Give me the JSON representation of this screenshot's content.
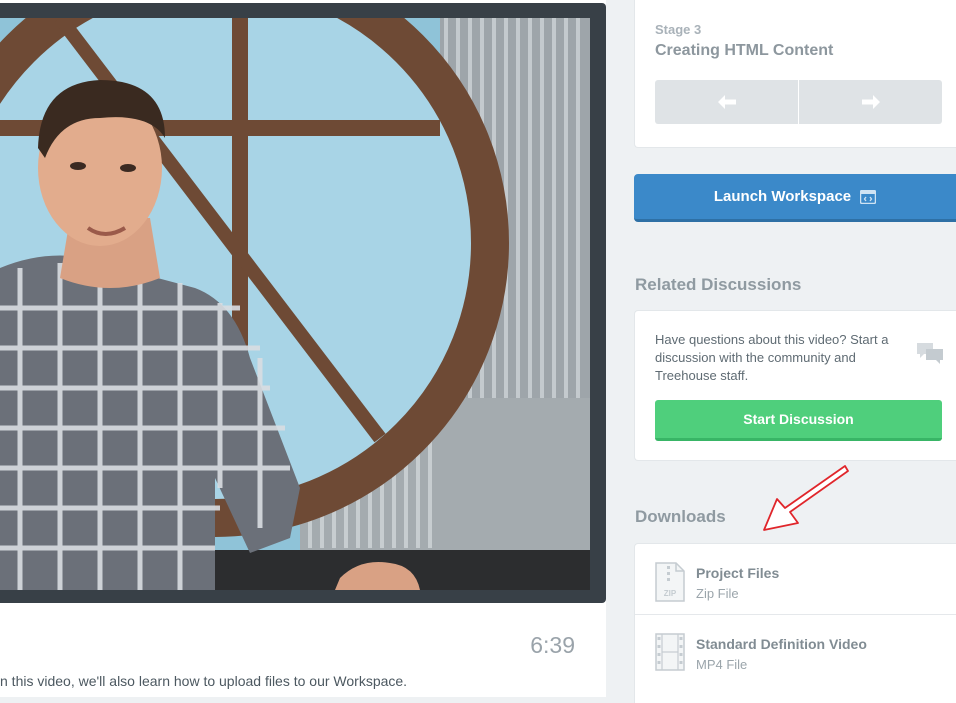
{
  "video": {
    "duration": "6:39",
    "description": "n this video, we'll also learn how to upload files to our Workspace."
  },
  "stage": {
    "label": "Stage 3",
    "title": "Creating HTML Content",
    "prev_icon": "arrow-left-icon",
    "next_icon": "arrow-right-icon"
  },
  "workspace": {
    "launch_label": "Launch Workspace",
    "icon": "workspace-window-icon"
  },
  "discussions": {
    "heading": "Related Discussions",
    "text": "Have questions about this video? Start a discussion with the community and Treehouse staff.",
    "start_label": "Start Discussion",
    "icon": "chat-bubbles-icon"
  },
  "downloads": {
    "heading": "Downloads",
    "items": [
      {
        "title": "Project Files",
        "subtitle": "Zip File",
        "icon": "zip-file-icon"
      },
      {
        "title": "Standard Definition Video",
        "subtitle": "MP4 File",
        "icon": "film-icon"
      }
    ]
  },
  "colors": {
    "launch": "#3b89c9",
    "start_discussion": "#4fcf7c",
    "annotation_arrow": "#e0262b"
  }
}
